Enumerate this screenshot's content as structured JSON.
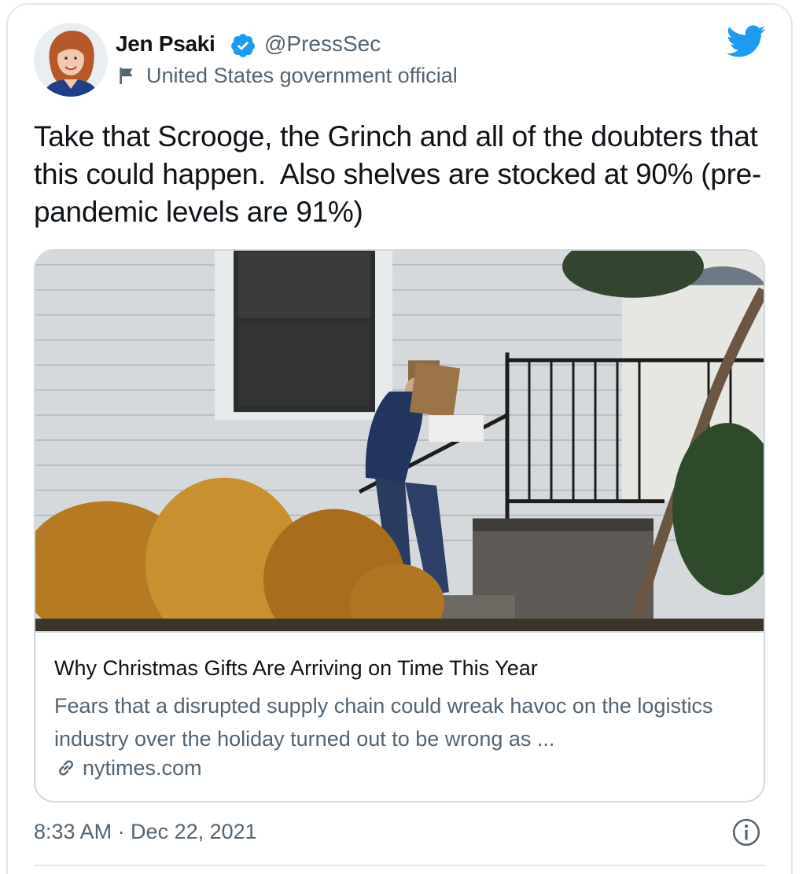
{
  "author": {
    "display_name": "Jen Psaki",
    "handle": "@PressSec",
    "verified": true,
    "label": "United States government official",
    "avatar_icon": "avatar-portrait"
  },
  "tweet": {
    "text": "Take that Scrooge, the Grinch and all of the doubters that this could happen.  Also shelves are stocked at 90% (pre-pandemic levels are 91%)",
    "timestamp": "8:33 AM · Dec 22, 2021"
  },
  "link_card": {
    "title": "Why Christmas Gifts Are Arriving on Time This Year",
    "description": "Fears that a disrupted supply chain could wreak havoc on the logistics industry over the holiday turned out to be wrong as ...",
    "domain": "nytimes.com",
    "image_icon": "delivery-photo"
  },
  "icons": {
    "brand": "twitter-bird-icon",
    "verified": "verified-badge-icon",
    "label": "flag-icon",
    "link": "link-chain-icon",
    "info": "info-icon"
  },
  "colors": {
    "brand_blue": "#1d9bf0",
    "text_primary": "#0f1419",
    "text_secondary": "#536471",
    "border": "#cfd9de"
  }
}
